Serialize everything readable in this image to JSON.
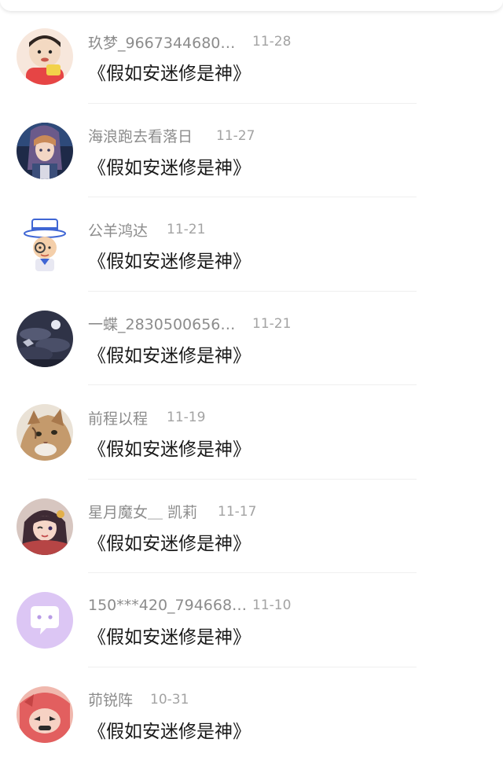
{
  "comments": [
    {
      "username": "玖梦_9667344680…",
      "date": "11-28",
      "text": "《假如安迷修是神》",
      "avatar": "cartoon-boy-red-shirt",
      "avatar_colors": [
        "#f6e3d2",
        "#e94b4b",
        "#3a2a22"
      ]
    },
    {
      "username": "海浪跑去看落日",
      "date": "11-27",
      "text": "《假如安迷修是神》",
      "avatar": "anime-girl-dark",
      "avatar_colors": [
        "#2a3552",
        "#d89a6a",
        "#5c7bb5"
      ]
    },
    {
      "username": "公羊鸿达",
      "date": "11-21",
      "text": "《假如安迷修是神》",
      "avatar": "cartoon-detective-hat",
      "avatar_colors": [
        "#ffffff",
        "#4a6fd6",
        "#f2c9a0"
      ]
    },
    {
      "username": "一蝶_2830500656…",
      "date": "11-21",
      "text": "《假如安迷修是神》",
      "avatar": "night-sky-moon",
      "avatar_colors": [
        "#3b3f55",
        "#8a8fa8",
        "#c9cbd8"
      ]
    },
    {
      "username": "前程以程",
      "date": "11-19",
      "text": "《假如安迷修是神》",
      "avatar": "cat-photo",
      "avatar_colors": [
        "#c9a57f",
        "#6b4a32",
        "#efe6da"
      ]
    },
    {
      "username": "星月魔女＿ 凯莉",
      "date": "11-17",
      "text": "《假如安迷修是神》",
      "avatar": "anime-girl-wink",
      "avatar_colors": [
        "#b54a4a",
        "#f4d2c2",
        "#3d2a36"
      ]
    },
    {
      "username": "150***420_794668…",
      "date": "11-10",
      "text": "《假如安迷修是神》",
      "avatar": "chat-bubble-icon",
      "avatar_colors": [
        "#d9c2f2",
        "#ffffff",
        "#b79be3"
      ]
    },
    {
      "username": "茆锐阵",
      "date": "10-31",
      "text": "《假如安迷修是神》",
      "avatar": "cartoon-red-character",
      "avatar_colors": [
        "#e46a6a",
        "#f5c6b8",
        "#2b2b2b"
      ]
    }
  ]
}
